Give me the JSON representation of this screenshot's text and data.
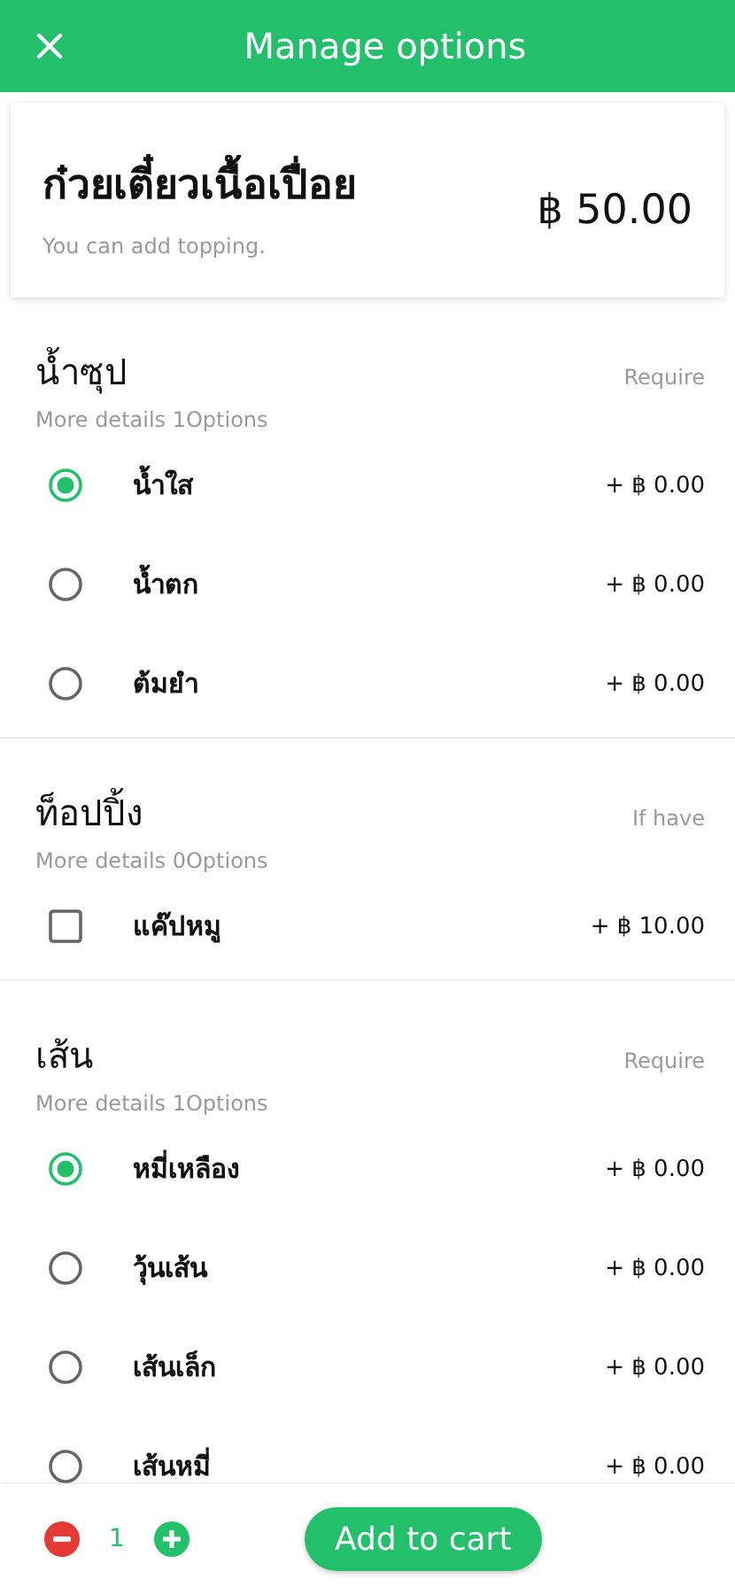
{
  "header": {
    "title": "Manage options"
  },
  "item": {
    "name": "ก๋วยเตี๋ยวเนื้อเปื่อย",
    "description": "You can add topping.",
    "price": "฿ 50.00"
  },
  "groups": [
    {
      "title": "น้ำซุป",
      "requirement": "Require",
      "details": "More details 1Options",
      "kind": "radio",
      "options": [
        {
          "label": "น้ำใส",
          "price": "+ ฿ 0.00",
          "selected": true
        },
        {
          "label": "น้ำตก",
          "price": "+ ฿ 0.00",
          "selected": false
        },
        {
          "label": "ต้มยำ",
          "price": "+ ฿ 0.00",
          "selected": false
        }
      ]
    },
    {
      "title": "ท็อปปิ้ง",
      "requirement": "If have",
      "details": "More details 0Options",
      "kind": "checkbox",
      "options": [
        {
          "label": "แค๊ปหมู",
          "price": "+ ฿ 10.00",
          "checked": false
        }
      ]
    },
    {
      "title": "เส้น",
      "requirement": "Require",
      "details": "More details 1Options",
      "kind": "radio",
      "options": [
        {
          "label": "หมี่เหลือง",
          "price": "+ ฿ 0.00",
          "selected": true
        },
        {
          "label": "วุ้นเส้น",
          "price": "+ ฿ 0.00",
          "selected": false
        },
        {
          "label": "เส้นเล็ก",
          "price": "+ ฿ 0.00",
          "selected": false
        },
        {
          "label": "เส้นหมี่",
          "price": "+ ฿ 0.00",
          "selected": false
        }
      ]
    }
  ],
  "cart": {
    "quantity": "1",
    "button": "Add to cart"
  }
}
